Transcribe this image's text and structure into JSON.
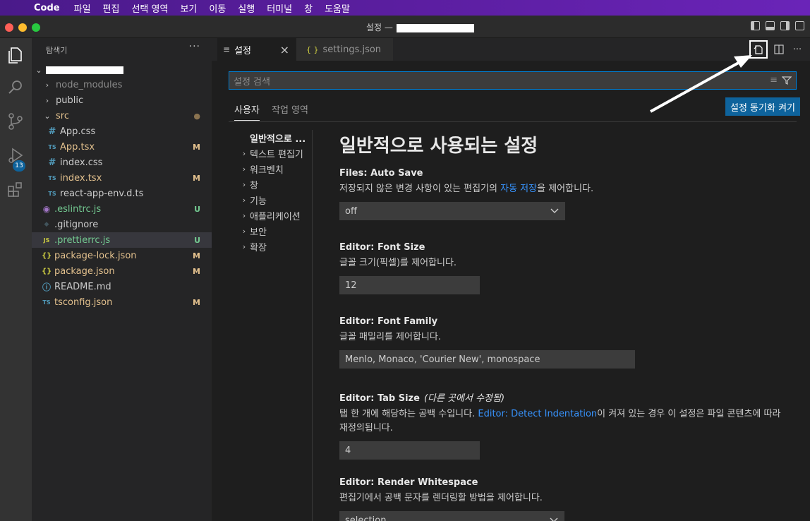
{
  "menubar": {
    "app": "Code",
    "items": [
      "파일",
      "편집",
      "선택 영역",
      "보기",
      "이동",
      "실행",
      "터미널",
      "창",
      "도움말"
    ]
  },
  "window": {
    "title": "설정 —"
  },
  "sidebar": {
    "title": "탐색기",
    "more": "···",
    "items": [
      {
        "name": "node_modules",
        "kind": "folder",
        "expanded": false
      },
      {
        "name": "public",
        "kind": "folder",
        "expanded": false
      },
      {
        "name": "src",
        "kind": "folder",
        "expanded": true
      },
      {
        "name": "App.css",
        "icon": "#",
        "status": ""
      },
      {
        "name": "App.tsx",
        "icon": "TS",
        "status": "M"
      },
      {
        "name": "index.css",
        "icon": "#",
        "status": ""
      },
      {
        "name": "index.tsx",
        "icon": "TS",
        "status": "M"
      },
      {
        "name": "react-app-env.d.ts",
        "icon": "TS",
        "status": ""
      },
      {
        "name": ".eslintrc.js",
        "icon": "◉",
        "status": "U"
      },
      {
        "name": ".gitignore",
        "icon": "◆",
        "status": ""
      },
      {
        "name": ".prettierrc.js",
        "icon": "JS",
        "status": "U"
      },
      {
        "name": "package-lock.json",
        "icon": "{}",
        "status": "M"
      },
      {
        "name": "package.json",
        "icon": "{}",
        "status": "M"
      },
      {
        "name": "README.md",
        "icon": "ⓘ",
        "status": ""
      },
      {
        "name": "tsconfig.json",
        "icon": "TS",
        "status": "M"
      }
    ]
  },
  "activity": {
    "source_control_badge": "13"
  },
  "tabs": [
    {
      "label": "설정",
      "icon": "≡",
      "active": true,
      "close": "×"
    },
    {
      "label": "settings.json",
      "icon": "{ }",
      "active": false
    }
  ],
  "settings": {
    "search_placeholder": "설정 검색",
    "scopes": [
      "사용자",
      "작업 영역"
    ],
    "sync_button": "설정 동기화 켜기",
    "toc": [
      "일반적으로 ...",
      "텍스트 편집기",
      "워크벤치",
      "창",
      "기능",
      "애플리케이션",
      "보안",
      "확장"
    ],
    "heading": "일반적으로 사용되는 설정",
    "items": [
      {
        "category": "Files:",
        "name": "Auto Save",
        "desc_pre": "저장되지 않은 변경 사항이 있는 편집기의 ",
        "desc_link": "자동 저장",
        "desc_post": "을 제어합니다.",
        "value": "off"
      },
      {
        "category": "Editor:",
        "name": "Font Size",
        "desc": "글꼴 크기(픽셀)를 제어합니다.",
        "value": "12"
      },
      {
        "category": "Editor:",
        "name": "Font Family",
        "desc": "글꼴 패밀리를 제어합니다.",
        "value": "Menlo, Monaco, 'Courier New', monospace"
      },
      {
        "category": "Editor:",
        "name": "Tab Size",
        "modified": "(다른 곳에서 수정됨)",
        "desc_pre": "탭 한 개에 해당하는 공백 수입니다. ",
        "desc_link": "Editor: Detect Indentation",
        "desc_post": "이 켜져 있는 경우 이 설정은 파일 콘텐츠에 따라 재정의됩니다.",
        "value": "4"
      },
      {
        "category": "Editor:",
        "name": "Render Whitespace",
        "desc": "편집기에서 공백 문자를 렌더링할 방법을 제어합니다.",
        "value": "selection"
      }
    ]
  },
  "colors": {
    "accent": "#0e639c",
    "link": "#3794ff",
    "modified": "#e2c08d",
    "untracked": "#73c991"
  }
}
